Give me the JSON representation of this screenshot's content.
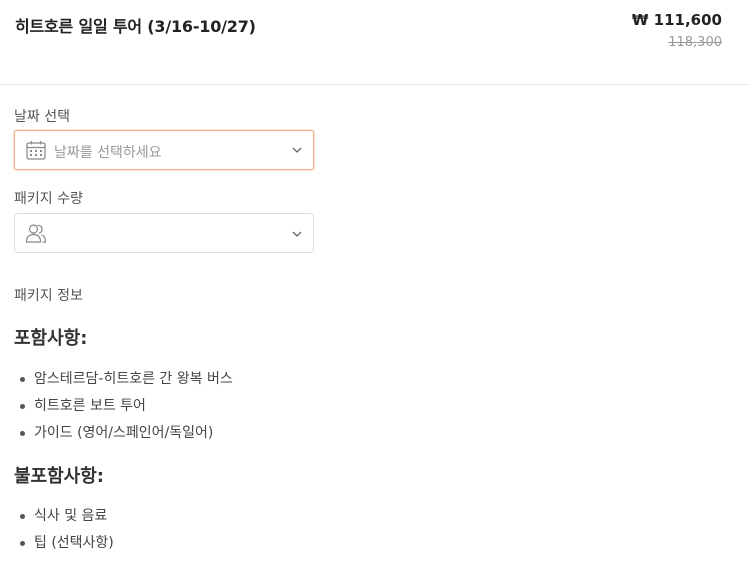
{
  "header": {
    "title": "히트호른 일일 투어 (3/16-10/27)",
    "price": "₩ 111,600",
    "original_price": "118,300"
  },
  "date_select": {
    "label": "날짜 선택",
    "placeholder": "날짜를 선택하세요",
    "icon": "calendar-icon"
  },
  "package_qty": {
    "label": "패키지 수량",
    "value": "",
    "icon": "users-icon"
  },
  "package_info": {
    "label": "패키지 정보",
    "included_heading": "포함사항:",
    "included": [
      "암스테르담-히트호른 간 왕복 버스",
      "히트호른 보트 투어",
      "가이드 (영어/스페인어/독일어)"
    ],
    "excluded_heading": "불포함사항:",
    "excluded": [
      "식사 및 음료",
      "팁 (선택사항)"
    ]
  },
  "colors": {
    "active_border": "#f5b089",
    "text_dark": "#222222",
    "placeholder": "#999999"
  }
}
